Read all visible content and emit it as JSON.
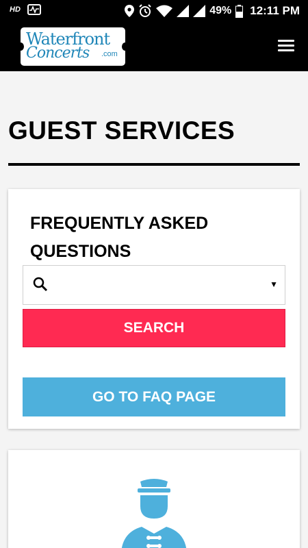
{
  "status_bar": {
    "network_label": "HD",
    "battery_percent": "49%",
    "time": "12:11 PM"
  },
  "header": {
    "logo_line1": "Waterfront",
    "logo_line2": "Concerts",
    "logo_suffix": ".com",
    "menu_icon": "hamburger-icon"
  },
  "page": {
    "title": "GUEST SERVICES"
  },
  "faq": {
    "heading": "FREQUENTLY ASKED QUESTIONS",
    "select_value": "",
    "search_label": "SEARCH",
    "faq_page_label": "GO TO FAQ PAGE"
  },
  "services": {
    "icon": "bellhop-icon"
  },
  "colors": {
    "search_button": "#ff2a52",
    "faq_button": "#4eb0dc",
    "logo_text": "#1f86b8",
    "header_bg": "#000000"
  }
}
